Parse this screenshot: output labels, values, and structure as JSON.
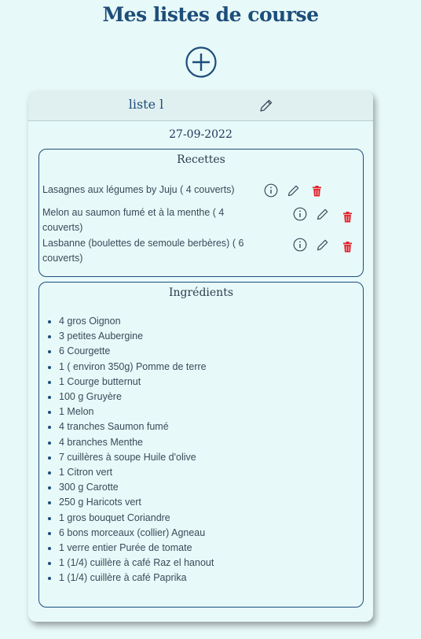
{
  "page": {
    "title": "Mes listes de course"
  },
  "list": {
    "title": "liste l",
    "date": "27-09-2022",
    "recipes_heading": "Recettes",
    "recipes": [
      {
        "line1": "Lasagnes aux légumes by Juju ( 4 couverts)",
        "line2": ""
      },
      {
        "line1": "Melon au saumon fumé et à la menthe ( 4",
        "line2": "couverts)"
      },
      {
        "line1": "Lasbanne (boulettes de semoule berbères) ( 6",
        "line2": "couverts)"
      }
    ],
    "ingredients_heading": "Ingrédients",
    "ingredients": [
      "4 gros Oignon",
      "3 petites Aubergine",
      "6 Courgette",
      "1 ( environ 350g) Pomme de terre",
      "1 Courge butternut",
      "100 g Gruyère",
      "1 Melon",
      "4 tranches Saumon fumé",
      "4 branches Menthe",
      "7 cuillères à soupe Huile d'olive",
      "1 Citron vert",
      "300 g Carotte",
      "250 g Haricots vert",
      "1 gros bouquet Coriandre",
      "6 bons morceaux (collier) Agneau",
      "1 verre entier Purée de tomate",
      "1 (1/4) cuillère à café Raz el hanout",
      "1 (1/4) cuillère à café Paprika"
    ]
  },
  "colors": {
    "background": "#e8f9f9",
    "accent": "#1d4e7a",
    "delete": "#e0202a"
  }
}
